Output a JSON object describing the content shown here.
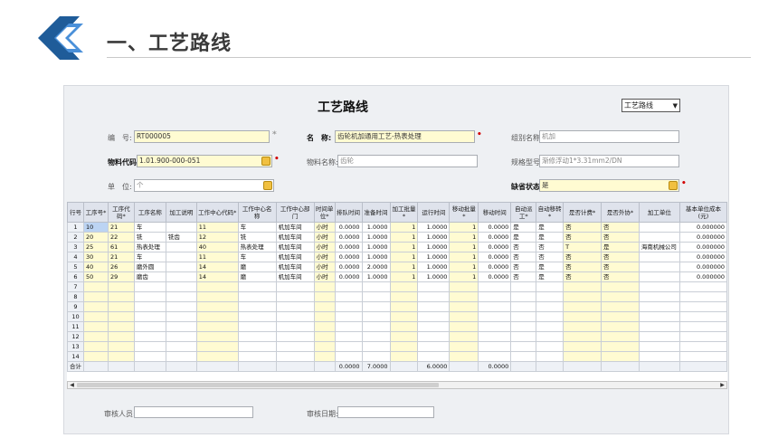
{
  "slide": {
    "title": "一、工艺路线"
  },
  "form": {
    "title": "工艺路线",
    "type_select": "工艺路线",
    "fields": {
      "code_label": "编　号:",
      "code_value": "RT000005",
      "name_label": "名　称:",
      "name_value": "齿轮机加通用工艺-热表处理",
      "group_label": "组别名称:",
      "group_value": "机加",
      "material_label": "物料代码:",
      "material_value": "1.01.900-000-051",
      "material_name_label": "物料名称:",
      "material_name_value": "齿轮",
      "spec_label": "规格型号:",
      "spec_value": "渐修浮动1*3.31mm2/DN",
      "unit_label": "单　位:",
      "unit_value": "个",
      "default_label": "缺省状态:",
      "default_value": "是"
    },
    "footer": {
      "auditor_label": "审核人员:",
      "audit_date_label": "审核日期:"
    }
  },
  "grid": {
    "columns": [
      "行号",
      "工序号*",
      "工序代码*",
      "工序名称",
      "加工说明",
      "工作中心代码*",
      "工作中心名称",
      "工作中心部门",
      "时间单位*",
      "排队时间",
      "准备时间",
      "加工批量*",
      "运行时间",
      "移动批量*",
      "移动时间",
      "自动派工*",
      "自动移转*",
      "是否计费*",
      "是否外协*",
      "加工单位",
      "基本单位成本(元)"
    ],
    "rows": [
      [
        "1",
        "10",
        "21",
        "车",
        "",
        "11",
        "车",
        "机加车间",
        "小时",
        "0.0000",
        "1.0000",
        "1",
        "1.0000",
        "1",
        "0.0000",
        "是",
        "是",
        "否",
        "否",
        "",
        "0.000000"
      ],
      [
        "2",
        "20",
        "22",
        "铣",
        "铣齿",
        "12",
        "铣",
        "机加车间",
        "小时",
        "0.0000",
        "1.0000",
        "1",
        "1.0000",
        "1",
        "0.0000",
        "是",
        "是",
        "否",
        "否",
        "",
        "0.000000"
      ],
      [
        "3",
        "25",
        "61",
        "热表处理",
        "",
        "40",
        "热表处理",
        "机加车间",
        "小时",
        "0.0000",
        "1.0000",
        "1",
        "1.0000",
        "1",
        "0.0000",
        "否",
        "否",
        "T",
        "是",
        "海南机械公司",
        "0.000000"
      ],
      [
        "4",
        "30",
        "21",
        "车",
        "",
        "11",
        "车",
        "机加车间",
        "小时",
        "0.0000",
        "1.0000",
        "1",
        "1.0000",
        "1",
        "0.0000",
        "否",
        "否",
        "否",
        "否",
        "",
        "0.000000"
      ],
      [
        "5",
        "40",
        "26",
        "磨外圆",
        "",
        "14",
        "磨",
        "机加车间",
        "小时",
        "0.0000",
        "2.0000",
        "1",
        "1.0000",
        "1",
        "0.0000",
        "否",
        "是",
        "否",
        "否",
        "",
        "0.000000"
      ],
      [
        "6",
        "50",
        "29",
        "磨齿",
        "",
        "14",
        "磨",
        "机加车间",
        "小时",
        "0.0000",
        "1.0000",
        "1",
        "1.0000",
        "1",
        "0.0000",
        "否",
        "是",
        "否",
        "否",
        "",
        "0.000000"
      ],
      [
        "7",
        "",
        "",
        "",
        "",
        "",
        "",
        "",
        "",
        "",
        "",
        "",
        "",
        "",
        "",
        "",
        "",
        "",
        "",
        "",
        ""
      ],
      [
        "8",
        "",
        "",
        "",
        "",
        "",
        "",
        "",
        "",
        "",
        "",
        "",
        "",
        "",
        "",
        "",
        "",
        "",
        "",
        "",
        ""
      ],
      [
        "9",
        "",
        "",
        "",
        "",
        "",
        "",
        "",
        "",
        "",
        "",
        "",
        "",
        "",
        "",
        "",
        "",
        "",
        "",
        "",
        ""
      ],
      [
        "10",
        "",
        "",
        "",
        "",
        "",
        "",
        "",
        "",
        "",
        "",
        "",
        "",
        "",
        "",
        "",
        "",
        "",
        "",
        "",
        ""
      ],
      [
        "11",
        "",
        "",
        "",
        "",
        "",
        "",
        "",
        "",
        "",
        "",
        "",
        "",
        "",
        "",
        "",
        "",
        "",
        "",
        "",
        ""
      ],
      [
        "12",
        "",
        "",
        "",
        "",
        "",
        "",
        "",
        "",
        "",
        "",
        "",
        "",
        "",
        "",
        "",
        "",
        "",
        "",
        "",
        ""
      ],
      [
        "13",
        "",
        "",
        "",
        "",
        "",
        "",
        "",
        "",
        "",
        "",
        "",
        "",
        "",
        "",
        "",
        "",
        "",
        "",
        "",
        ""
      ],
      [
        "14",
        "",
        "",
        "",
        "",
        "",
        "",
        "",
        "",
        "",
        "",
        "",
        "",
        "",
        "",
        "",
        "",
        "",
        "",
        "",
        ""
      ]
    ],
    "total": [
      "合计",
      "",
      "",
      "",
      "",
      "",
      "",
      "",
      "",
      "0.0000",
      "7.0000",
      "",
      "6.0000",
      "",
      "0.0000",
      "",
      "",
      "",
      "",
      "",
      ""
    ]
  },
  "colors": {
    "accent_blue": "#1f5c99",
    "light_blue": "#4a90d9",
    "required_red": "#d20000",
    "field_yellow": "#fffbd2"
  }
}
